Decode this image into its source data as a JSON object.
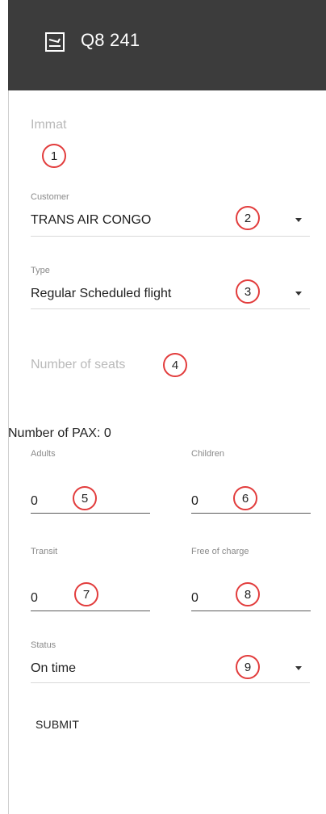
{
  "header": {
    "title": "Q8 241",
    "icon": "flight-icon"
  },
  "form": {
    "immat": {
      "placeholder": "Immat",
      "badge": "1"
    },
    "customer": {
      "label": "Customer",
      "value": "TRANS AIR CONGO",
      "badge": "2"
    },
    "type": {
      "label": "Type",
      "value": "Regular Scheduled flight",
      "badge": "3"
    },
    "seats": {
      "placeholder": "Number of seats",
      "badge": "4"
    },
    "pax": {
      "title": "Number of PAX: 0",
      "adults": {
        "label": "Adults",
        "value": "0",
        "badge": "5"
      },
      "children": {
        "label": "Children",
        "value": "0",
        "badge": "6"
      },
      "transit": {
        "label": "Transit",
        "value": "0",
        "badge": "7"
      },
      "free": {
        "label": "Free of charge",
        "value": "0",
        "badge": "8"
      }
    },
    "status": {
      "label": "Status",
      "value": "On time",
      "badge": "9"
    },
    "submit_label": "SUBMIT"
  }
}
